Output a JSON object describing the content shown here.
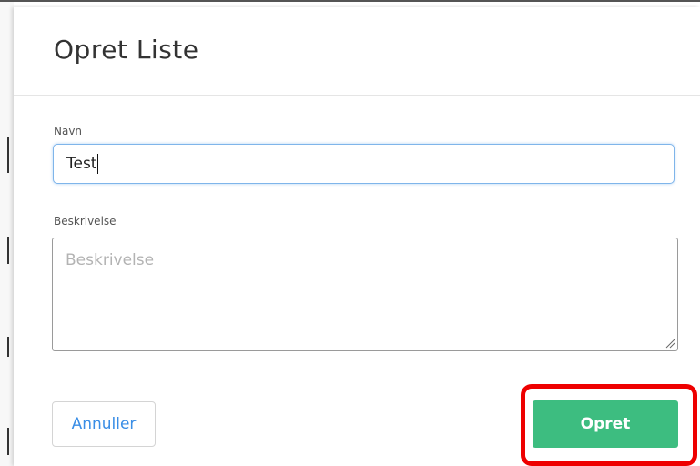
{
  "dialog": {
    "title": "Opret Liste",
    "name_label": "Navn",
    "name_value": "Test",
    "description_label": "Beskrivelse",
    "description_placeholder": "Beskrivelse",
    "cancel_label": "Annuller",
    "create_label": "Opret"
  },
  "colors": {
    "accent_green": "#3dbd80",
    "link_blue": "#3a8ee6",
    "highlight_red": "#ee0000"
  }
}
